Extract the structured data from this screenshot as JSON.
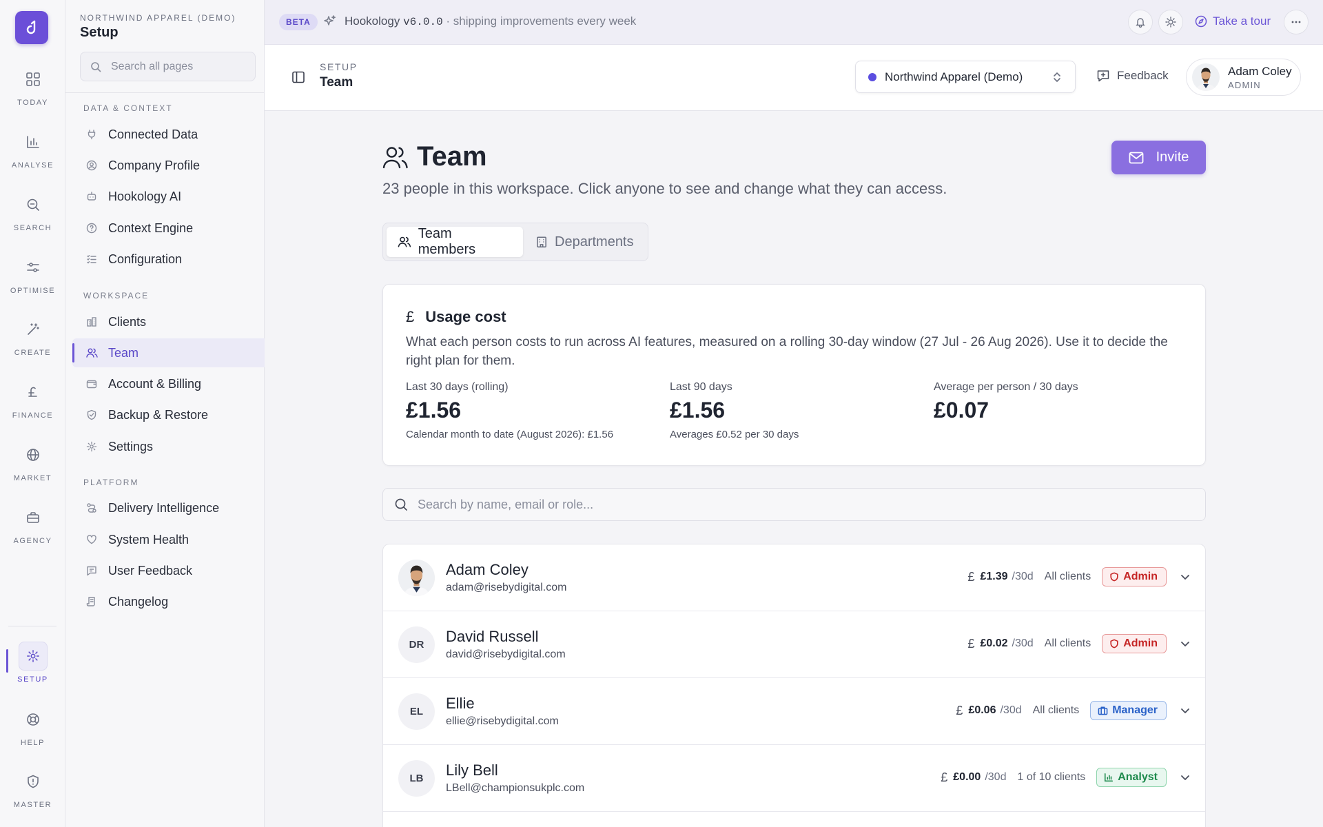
{
  "rail": {
    "items": [
      {
        "label": "TODAY",
        "icon": "grid-icon"
      },
      {
        "label": "ANALYSE",
        "icon": "bar-chart-icon"
      },
      {
        "label": "SEARCH",
        "icon": "search-zoom-icon"
      },
      {
        "label": "OPTIMISE",
        "icon": "sliders-icon"
      },
      {
        "label": "CREATE",
        "icon": "magic-wand-icon"
      },
      {
        "label": "FINANCE",
        "icon": "pound-icon"
      },
      {
        "label": "MARKET",
        "icon": "globe-icon"
      },
      {
        "label": "AGENCY",
        "icon": "briefcase-icon"
      },
      {
        "label": "SETUP",
        "icon": "gear-icon",
        "active": true
      },
      {
        "label": "HELP",
        "icon": "lifebuoy-icon"
      },
      {
        "label": "MASTER",
        "icon": "shield-icon"
      }
    ],
    "accent": "#6b4fd8"
  },
  "sidebar": {
    "org": "NORTHWIND APPAREL (DEMO)",
    "title": "Setup",
    "search_placeholder": "Search all pages",
    "groups": [
      {
        "label": "DATA & CONTEXT",
        "items": [
          "Connected Data",
          "Company Profile",
          "Hookology AI",
          "Context Engine",
          "Configuration"
        ]
      },
      {
        "label": "WORKSPACE",
        "items": [
          "Clients",
          "Team",
          "Account & Billing",
          "Backup & Restore",
          "Settings"
        ]
      },
      {
        "label": "PLATFORM",
        "items": [
          "Delivery Intelligence",
          "System Health",
          "User Feedback",
          "Changelog"
        ]
      }
    ],
    "active_item": "Team"
  },
  "banner": {
    "badge": "BETA",
    "app": "Hookology",
    "version": "v6.0.0",
    "tagline": "· shipping improvements every week",
    "tour": "Take a tour"
  },
  "header": {
    "breadcrumb_small": "SETUP",
    "breadcrumb_big": "Team",
    "org_select": "Northwind Apparel (Demo)",
    "feedback": "Feedback",
    "user_name": "Adam Coley",
    "user_role": "ADMIN"
  },
  "main": {
    "title": "Team",
    "subtitle": "23 people in this workspace. Click anyone to see and change what they can access.",
    "invite": "Invite",
    "tabs": [
      {
        "label": "Team members",
        "active": true
      },
      {
        "label": "Departments",
        "active": false
      }
    ],
    "usage": {
      "symbol": "£",
      "title": "Usage cost",
      "description": "What each person costs to run across AI features, measured on a rolling 30-day window (27 Jul - 26 Aug 2026). Use it to decide the right plan for them.",
      "stats": [
        {
          "label": "Last 30 days (rolling)",
          "value": "£1.56",
          "note": "Calendar month to date (August 2026): £1.56"
        },
        {
          "label": "Last 90 days",
          "value": "£1.56",
          "note": "Averages £0.52 per 30 days"
        },
        {
          "label": "Average per person / 30 days",
          "value": "£0.07",
          "note": ""
        }
      ]
    },
    "search_placeholder": "Search by name, email or role...",
    "members": [
      {
        "initials": "",
        "photo": true,
        "name": "Adam Coley",
        "email": "adam@risebydigital.com",
        "cost": "£1.39",
        "per": "/30d",
        "scope": "All clients",
        "role": "Admin",
        "role_type": "admin"
      },
      {
        "initials": "DR",
        "photo": false,
        "name": "David Russell",
        "email": "david@risebydigital.com",
        "cost": "£0.02",
        "per": "/30d",
        "scope": "All clients",
        "role": "Admin",
        "role_type": "admin"
      },
      {
        "initials": "EL",
        "photo": false,
        "name": "Ellie",
        "email": "ellie@risebydigital.com",
        "cost": "£0.06",
        "per": "/30d",
        "scope": "All clients",
        "role": "Manager",
        "role_type": "manager"
      },
      {
        "initials": "LB",
        "photo": false,
        "name": "Lily Bell",
        "email": "LBell@championsukplc.com",
        "cost": "£0.00",
        "per": "/30d",
        "scope": "1 of 10 clients",
        "role": "Analyst",
        "role_type": "analyst"
      }
    ],
    "pound_glyph": "£"
  }
}
